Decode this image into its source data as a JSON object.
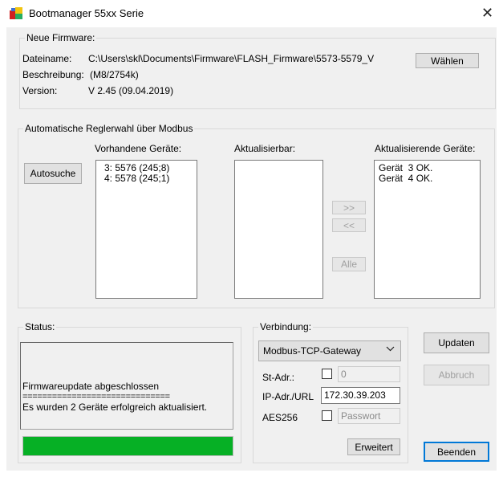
{
  "window": {
    "title": "Bootmanager 55xx Serie",
    "close_glyph": "✕"
  },
  "firmware": {
    "group_title": "Neue Firmware:",
    "filename_label": "Dateiname:",
    "filename_value": "C:\\Users\\skl\\Documents\\Firmware\\FLASH_Firmware\\5573-5579_V",
    "choose_button": "Wählen",
    "description_label": "Beschreibung:",
    "description_value": "(M8/2754k)",
    "version_label": "Version:",
    "version_value": "V 2.45 (09.04.2019)"
  },
  "modbus": {
    "group_title": "Automatische Reglerwahl über Modbus",
    "autosearch_button": "Autosuche",
    "available_label": "Vorhandene Geräte:",
    "available_items": [
      "3: 5576 (245;8)",
      "4: 5578 (245;1)"
    ],
    "updatable_label": "Aktualisierbar:",
    "updatable_items": [],
    "updating_label": "Aktualisierende Geräte:",
    "updating_items": [
      "Gerät  3 OK.",
      "Gerät  4 OK."
    ],
    "move_right_button": ">>",
    "move_left_button": "<<",
    "all_button": "Alle"
  },
  "status": {
    "group_title": "Status:",
    "lines": [
      "Firmwareupdate abgeschlossen",
      "==============================",
      "Es wurden 2 Geräte erfolgreich aktualisiert."
    ],
    "progress_fraction": 1.0,
    "progress_color": "#06b025"
  },
  "connection": {
    "group_title": "Verbindung:",
    "type_selected": "Modbus-TCP-Gateway",
    "st_addr_label": "St-Adr.:",
    "st_addr_checked": false,
    "st_addr_value": "0",
    "ip_label": "IP-Adr./URL",
    "ip_value": "172.30.39.203",
    "aes_label": "AES256",
    "aes_checked": false,
    "password_placeholder": "Passwort",
    "extended_button": "Erweitert"
  },
  "actions": {
    "update_button": "Updaten",
    "abort_button": "Abbruch",
    "exit_button": "Beenden"
  },
  "icons": {
    "app": "bootmanager-app-icon",
    "dropdown": "chevron-down-icon",
    "close": "close-icon"
  },
  "colors": {
    "accent": "#0078d7",
    "window_bg": "#f0f0f0"
  }
}
